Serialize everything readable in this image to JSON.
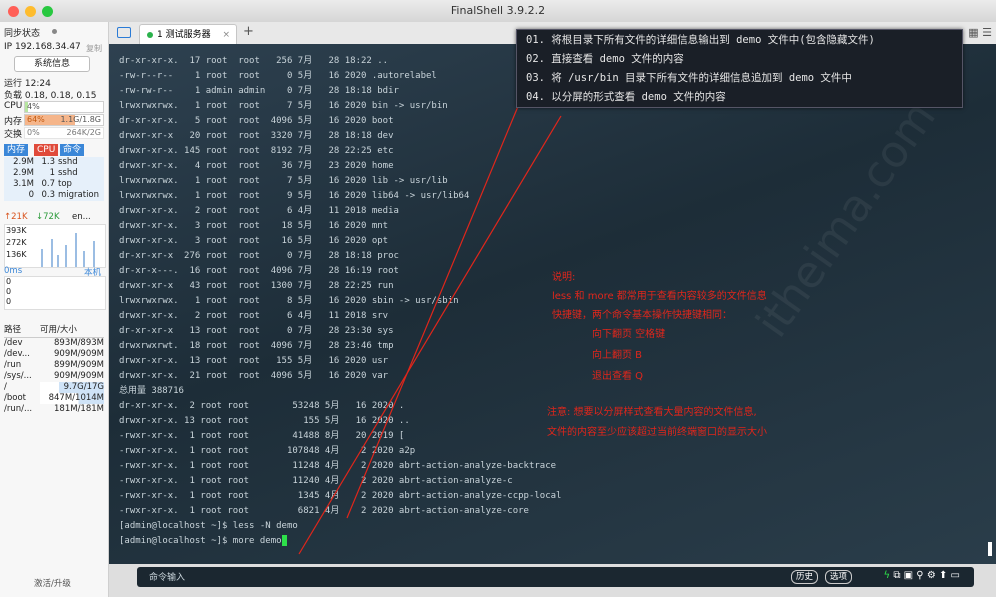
{
  "window": {
    "title": "FinalShell 3.9.2.2"
  },
  "sidebar": {
    "sync_status": "同步状态",
    "ip": "IP 192.168.34.47",
    "copy": "复制",
    "sysinfo_button": "系统信息",
    "uptime": "运行 12:24",
    "load": "负载 0.18, 0.18, 0.15",
    "cpu_label": "CPU",
    "cpu_value": "4%",
    "cpu_fraction": 0.04,
    "mem_label": "内存",
    "mem_percent": "64%",
    "mem_value": "1.1G/1.8G",
    "mem_fraction": 0.64,
    "swap_label": "交换",
    "swap_percent": "0%",
    "swap_value": "264K/2G",
    "proc_tabs": [
      "内存",
      "CPU",
      "命令"
    ],
    "processes": [
      {
        "mem": "2.9M",
        "cpu": "1.3",
        "cmd": "sshd"
      },
      {
        "mem": "2.9M",
        "cpu": "1",
        "cmd": "sshd"
      },
      {
        "mem": "3.1M",
        "cpu": "0.7",
        "cmd": "top"
      },
      {
        "mem": "0",
        "cpu": "0.3",
        "cmd": "migration"
      }
    ],
    "net_up": "↑21K",
    "net_down": "↓72K",
    "net_iface": "en...",
    "net_ticks": [
      "393K",
      "272K",
      "136K"
    ],
    "latency_label": "0ms",
    "latency_host": "本机",
    "latency_ticks": [
      "0",
      "0",
      "0"
    ],
    "disk_headers": [
      "路径",
      "可用/大小"
    ],
    "disks": [
      {
        "path": "/dev",
        "size": "893M/893M"
      },
      {
        "path": "/dev...",
        "size": "909M/909M"
      },
      {
        "path": "/run",
        "size": "899M/909M"
      },
      {
        "path": "/sys/...",
        "size": "909M/909M"
      },
      {
        "path": "/",
        "size": "9.7G/17G"
      },
      {
        "path": "/boot",
        "size": "847M/1014M"
      },
      {
        "path": "/run/...",
        "size": "181M/181M"
      }
    ],
    "activate": "激活/升级"
  },
  "tabs": {
    "session": "1 测试服务器"
  },
  "terminal": {
    "lines": [
      "dr-xr-xr-x.  17 root  root   256 7月   28 18:22 ..",
      "-rw-r--r--    1 root  root     0 5月   16 2020 .autorelabel",
      "-rw-rw-r--    1 admin admin    0 7月   28 18:18 bdir",
      "lrwxrwxrwx.   1 root  root     7 5月   16 2020 bin -> usr/bin",
      "dr-xr-xr-x.   5 root  root  4096 5月   16 2020 boot",
      "drwxr-xr-x   20 root  root  3320 7月   28 18:18 dev",
      "drwxr-xr-x. 145 root  root  8192 7月   28 22:25 etc",
      "drwxr-xr-x.   4 root  root    36 7月   23 2020 home",
      "lrwxrwxrwx.   1 root  root     7 5月   16 2020 lib -> usr/lib",
      "lrwxrwxrwx.   1 root  root     9 5月   16 2020 lib64 -> usr/lib64",
      "drwxr-xr-x.   2 root  root     6 4月   11 2018 media",
      "drwxr-xr-x.   3 root  root    18 5月   16 2020 mnt",
      "drwxr-xr-x.   3 root  root    16 5月   16 2020 opt",
      "dr-xr-xr-x  276 root  root     0 7月   28 18:18 proc",
      "dr-xr-x---.  16 root  root  4096 7月   28 16:19 root",
      "drwxr-xr-x   43 root  root  1300 7月   28 22:25 run",
      "lrwxrwxrwx.   1 root  root     8 5月   16 2020 sbin -> usr/sbin",
      "drwxr-xr-x.   2 root  root     6 4月   11 2018 srv",
      "dr-xr-xr-x   13 root  root     0 7月   28 23:30 sys",
      "drwxrwxrwt.  18 root  root  4096 7月   28 23:46 tmp",
      "drwxr-xr-x.  13 root  root   155 5月   16 2020 usr",
      "drwxr-xr-x.  21 root  root  4096 5月   16 2020 var",
      "总用量 388716",
      "dr-xr-xr-x.  2 root root        53248 5月   16 2020 .",
      "drwxr-xr-x. 13 root root          155 5月   16 2020 ..",
      "-rwxr-xr-x.  1 root root        41488 8月   20 2019 [",
      "-rwxr-xr-x.  1 root root       107848 4月    2 2020 a2p",
      "-rwxr-xr-x.  1 root root        11248 4月    2 2020 abrt-action-analyze-backtrace",
      "-rwxr-xr-x.  1 root root        11240 4月    2 2020 abrt-action-analyze-c",
      "-rwxr-xr-x.  1 root root         1345 4月    2 2020 abrt-action-analyze-ccpp-local",
      "-rwxr-xr-x.  1 root root         6821 4月    2 2020 abrt-action-analyze-core",
      "[admin@localhost ~]$ less -N demo"
    ],
    "prompt_line": "[admin@localhost ~]$ more demo"
  },
  "tasks": [
    "01. 将根目录下所有文件的详细信息输出到 demo 文件中(包含隐藏文件)",
    "02. 直接查看 demo 文件的内容",
    "03. 将 /usr/bin 目录下所有文件的详细信息追加到 demo 文件中",
    "04. 以分屏的形式查看 demo 文件的内容"
  ],
  "notes": {
    "title": "说明:",
    "line1": "less 和 more 都常用于查看内容较多的文件信息",
    "line2": "快捷键，两个命令基本操作快捷键相同：",
    "key1": "向下翻页  空格键",
    "key2": "向上翻页  B",
    "key3": "退出查看  Q",
    "warn1": "注意: 想要以分屏样式查看大量内容的文件信息,",
    "warn2": "文件的内容至少应该超过当前终端窗口的显示大小"
  },
  "cmdbar": {
    "label": "命令输入",
    "history": "历史",
    "options": "选项"
  },
  "colors": {
    "terminal_bg": "#24343f",
    "annotation": "#e0261b",
    "cursor": "#2de04a"
  }
}
